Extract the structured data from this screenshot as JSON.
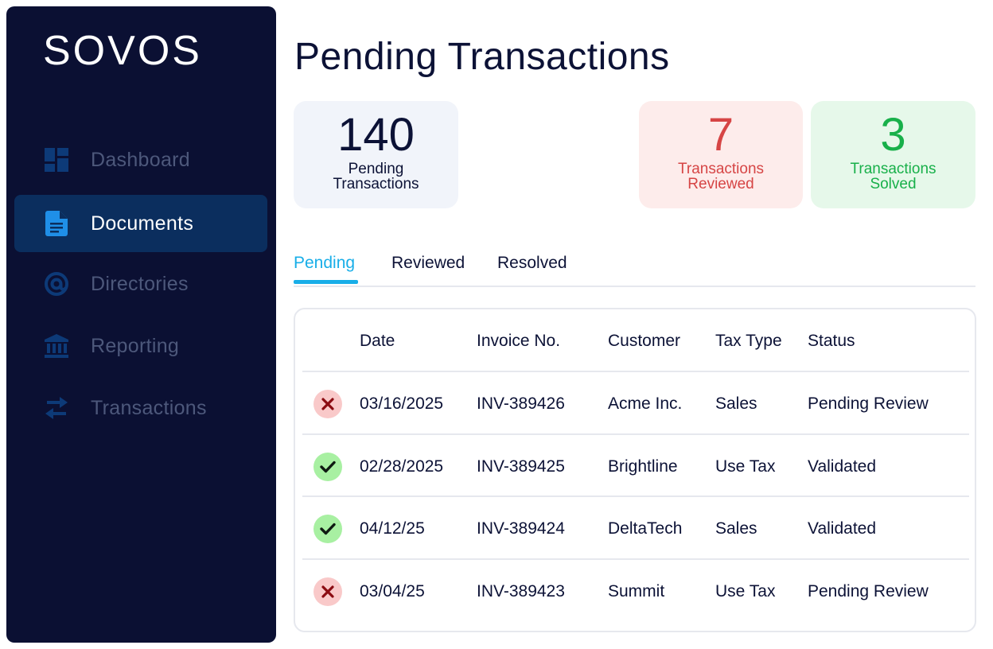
{
  "brand": {
    "logo": "SOVOS"
  },
  "sidebar": {
    "items": [
      {
        "label": "Dashboard",
        "icon": "dashboard-icon",
        "active": false
      },
      {
        "label": "Documents",
        "icon": "document-icon",
        "active": true
      },
      {
        "label": "Directories",
        "icon": "at-sign-icon",
        "active": false
      },
      {
        "label": "Reporting",
        "icon": "bank-icon",
        "active": false
      },
      {
        "label": "Transactions",
        "icon": "transfer-arrows-icon",
        "active": false
      }
    ]
  },
  "page": {
    "title": "Pending Transactions"
  },
  "summary": {
    "pending": {
      "value": "140",
      "label_line1": "Pending",
      "label_line2": "Transactions"
    },
    "reviewed": {
      "value": "7",
      "label_line1": "Transactions",
      "label_line2": "Reviewed"
    },
    "solved": {
      "value": "3",
      "label_line1": "Transactions",
      "label_line2": "Solved"
    }
  },
  "tabs": [
    {
      "label": "Pending",
      "active": true
    },
    {
      "label": "Reviewed",
      "active": false
    },
    {
      "label": "Resolved",
      "active": false
    }
  ],
  "table": {
    "columns": [
      "Date",
      "Invoice No.",
      "Customer",
      "Tax Type",
      "Status"
    ],
    "rows": [
      {
        "icon": "x-icon",
        "date": "03/16/2025",
        "invoice": "INV-389426",
        "customer": "Acme Inc.",
        "tax_type": "Sales",
        "status": "Pending Review"
      },
      {
        "icon": "check-icon",
        "date": "02/28/2025",
        "invoice": "INV-389425",
        "customer": "Brightline",
        "tax_type": "Use Tax",
        "status": "Validated"
      },
      {
        "icon": "check-icon",
        "date": "04/12/25",
        "invoice": "INV-389424",
        "customer": "DeltaTech",
        "tax_type": "Sales",
        "status": "Validated"
      },
      {
        "icon": "x-icon",
        "date": "03/04/25",
        "invoice": "INV-389423",
        "customer": "Summit",
        "tax_type": "Use Tax",
        "status": "Pending Review"
      }
    ]
  },
  "colors": {
    "sidebar_bg": "#0b1033",
    "active_nav_bg": "#0b2e5e",
    "accent": "#18aee8",
    "reviewed": "#d64545",
    "solved": "#18b04a"
  }
}
